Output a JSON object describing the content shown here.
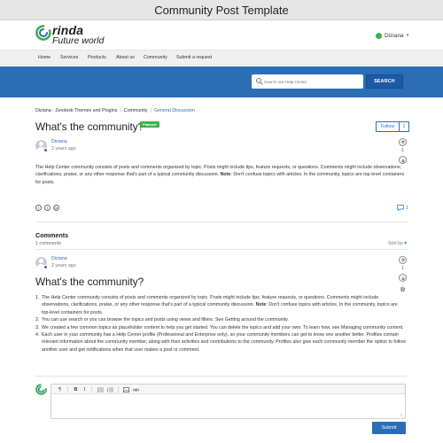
{
  "template_title": "Community Post Template",
  "brand": {
    "name": "rinda",
    "tagline": "Future world",
    "accent": "#2b6eb6",
    "logo_green": "#3cb04b"
  },
  "user_menu": {
    "name": "Diziana",
    "icon": "user-avatar-icon"
  },
  "nav": {
    "items": [
      {
        "label": "Home"
      },
      {
        "label": "Services"
      },
      {
        "label": "Products"
      },
      {
        "label": "About us"
      },
      {
        "label": "Community"
      },
      {
        "label": "Submit a request"
      }
    ]
  },
  "search": {
    "placeholder": "Search our Help Center",
    "button_label": "SEARCH"
  },
  "breadcrumb": {
    "items": [
      {
        "label": "Diziana - Zendesk Themes and Plugins"
      },
      {
        "label": "Community"
      },
      {
        "label": "General Discussion"
      }
    ],
    "separator": "|"
  },
  "post": {
    "title": "What's the community?",
    "badge": "Planned",
    "follow_label": "Follow",
    "follow_count": "1",
    "author": "Diziana",
    "time": "3 years ago",
    "vote_count": "1",
    "body_before_note": "The Help Center community consists of posts and comments organized by topic. Posts might include tips, feature requests, or questions. Comments might include observations, clarifications, praise, or any other response that's part of a typical community discussion.",
    "note_label": "Note",
    "body_after_note": ": Don't confuse topics with articles. In the community, topics are top-level containers for posts.",
    "share_icons": [
      "facebook-icon",
      "twitter-icon",
      "linkedin-icon"
    ],
    "comment_count": "1"
  },
  "comments": {
    "heading": "Comments",
    "count_label": "1 comments",
    "sort_label": "Sort by",
    "items": [
      {
        "author": "Diziana",
        "time": "3 years ago",
        "vote_count": "1",
        "title": "What's the community?",
        "list": [
          {
            "num": "1.",
            "text_before": "The Help Center community consists of posts and comments organized by topic. Posts might include tips, feature requests, or questions. Comments might include observations, clarifications, praise, or any other response that's part of a typical community discussion.",
            "note_label": "Note",
            "text_after": ": Don't confuse topics with articles. In the community, topics are top-level containers for posts."
          },
          {
            "num": "2.",
            "text": "You can use search or you can browse the topics and posts using views and filters. See Getting around the community."
          },
          {
            "num": "3.",
            "text": "We created a few common topics as placeholder content to help you get started. You can delete the topics and add your own. To learn how, see Managing community content."
          },
          {
            "num": "4.",
            "text": "Each user in your community has a Help Center profile (Professional and Enterprise only), so your community members can get to know one another better. Profiles contain relevant information about the community member, along with their activities and contributions to the community. Profiles also give each community member the option to follow another user and get notifications when that user makes a post or comment."
          }
        ]
      }
    ]
  },
  "editor": {
    "toolbar": [
      "paragraph-icon",
      "bold-icon",
      "italic-icon",
      "bulleted-list-icon",
      "numbered-list-icon",
      "image-icon",
      "link-icon"
    ],
    "toolbar_glyphs": {
      "paragraph": "¶",
      "bold": "B",
      "italic": "I"
    },
    "submit_label": "Submit"
  }
}
